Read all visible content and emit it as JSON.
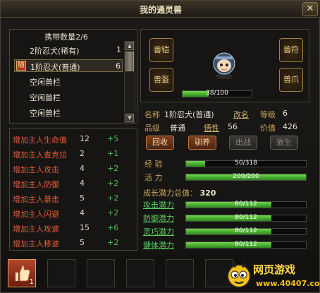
{
  "window": {
    "title": "我的通灵兽",
    "close_icon": "close-icon"
  },
  "carry": {
    "header": "携带数量2/6",
    "items": [
      {
        "name": "2阶忍犬(稀有)",
        "count": "1"
      },
      {
        "badge": "随",
        "name": "1阶忍犬(普通)",
        "count": "6"
      },
      {
        "name": "空闲兽栏",
        "count": ""
      },
      {
        "name": "空闲兽栏",
        "count": ""
      },
      {
        "name": "空闲兽栏",
        "count": ""
      }
    ]
  },
  "bonuses": [
    {
      "name": "增加主人生命值",
      "value": "12",
      "plus": "+5"
    },
    {
      "name": "增加主人查克拉",
      "value": "2",
      "plus": "+1"
    },
    {
      "name": "增加主人攻击",
      "value": "4",
      "plus": "+2"
    },
    {
      "name": "增加主人防御",
      "value": "4",
      "plus": "+2"
    },
    {
      "name": "增加主人暴击",
      "value": "5",
      "plus": "+2"
    },
    {
      "name": "增加主人闪避",
      "value": "4",
      "plus": "+2"
    },
    {
      "name": "增加主人攻速",
      "value": "15",
      "plus": "+6"
    },
    {
      "name": "增加主人移速",
      "value": "5",
      "plus": "+2"
    }
  ],
  "equipment": {
    "armor": "兽铠",
    "charm": "兽符",
    "helmet": "兽盔",
    "claw": "兽爪"
  },
  "pet_hp": {
    "text": "38/100",
    "fraction": 0.38
  },
  "info": {
    "name_label": "名称",
    "name_value": "1阶忍犬(普通)",
    "rename": "改名",
    "level_label": "等级",
    "level_value": "6",
    "quality_label": "品级",
    "quality_value": "普通",
    "temper_label": "悟性",
    "temper_value": "56",
    "price_label": "价值",
    "price_value": "426"
  },
  "actions": {
    "recycle": "回收",
    "tame": "驯养",
    "battle": "出战",
    "revive": "放生"
  },
  "stats": {
    "exp_label": "经 验",
    "exp_text": "50/318",
    "exp_fraction": 0.157,
    "vit_label": "活 力",
    "vit_text": "200/200",
    "vit_fraction": 1.0
  },
  "potential": {
    "total_label": "成长潜力总值：",
    "total_value": "320",
    "rows": [
      {
        "label": "攻击潜力",
        "text": "80/112",
        "fraction": 0.714
      },
      {
        "label": "防御潜力",
        "text": "80/112",
        "fraction": 0.714
      },
      {
        "label": "灵巧潜力",
        "text": "80/112",
        "fraction": 0.714
      },
      {
        "label": "健体潜力",
        "text": "80/112",
        "fraction": 0.714
      }
    ]
  },
  "bottom": {
    "first_item_count": "1"
  },
  "watermark": {
    "title": "网页游戏",
    "url": "www.40407.com"
  },
  "colors": {
    "accent": "#c9a35a",
    "bonus": "#e65a3a",
    "bar": "#4cbf35"
  }
}
